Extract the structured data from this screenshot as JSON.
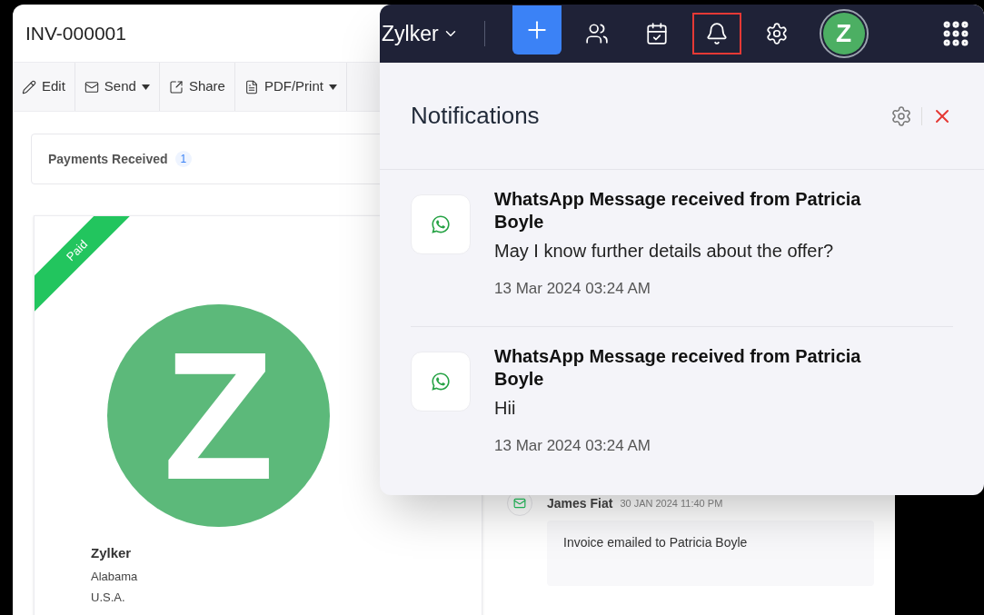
{
  "invoice": {
    "title": "INV-000001",
    "actions": [
      {
        "label": "Edit",
        "kind": "edit",
        "dropdown": false
      },
      {
        "label": "Send",
        "kind": "send",
        "dropdown": true
      },
      {
        "label": "Share",
        "kind": "share",
        "dropdown": false
      },
      {
        "label": "PDF/Print",
        "kind": "pdf",
        "dropdown": true
      }
    ],
    "payments": {
      "label": "Payments Received",
      "count": "1"
    },
    "document": {
      "ribbon": "Paid",
      "logo_letter": "Z",
      "company": "Zylker",
      "address": [
        "Alabama",
        "U.S.A."
      ]
    },
    "activity": [
      {
        "author": "James Fiat",
        "time": "30 JAN 2024 11:40 PM",
        "message": "Invoice emailed to Patricia Boyle"
      }
    ]
  },
  "topbar": {
    "org": "Zylker",
    "avatar": "Z",
    "tools": [
      {
        "kind": "add",
        "highlighted": false
      },
      {
        "kind": "users",
        "highlighted": false
      },
      {
        "kind": "tasks",
        "highlighted": false
      },
      {
        "kind": "bell",
        "highlighted": true
      },
      {
        "kind": "settings",
        "highlighted": false
      }
    ]
  },
  "notifications": {
    "title": "Notifications",
    "items": [
      {
        "title": "WhatsApp Message received from Patricia Boyle",
        "message": "May I know further details about the offer?",
        "time": "13 Mar 2024 03:24 AM"
      },
      {
        "title": "WhatsApp Message received from Patricia Boyle",
        "message": "Hii",
        "time": "13 Mar 2024 03:24 AM"
      }
    ]
  }
}
